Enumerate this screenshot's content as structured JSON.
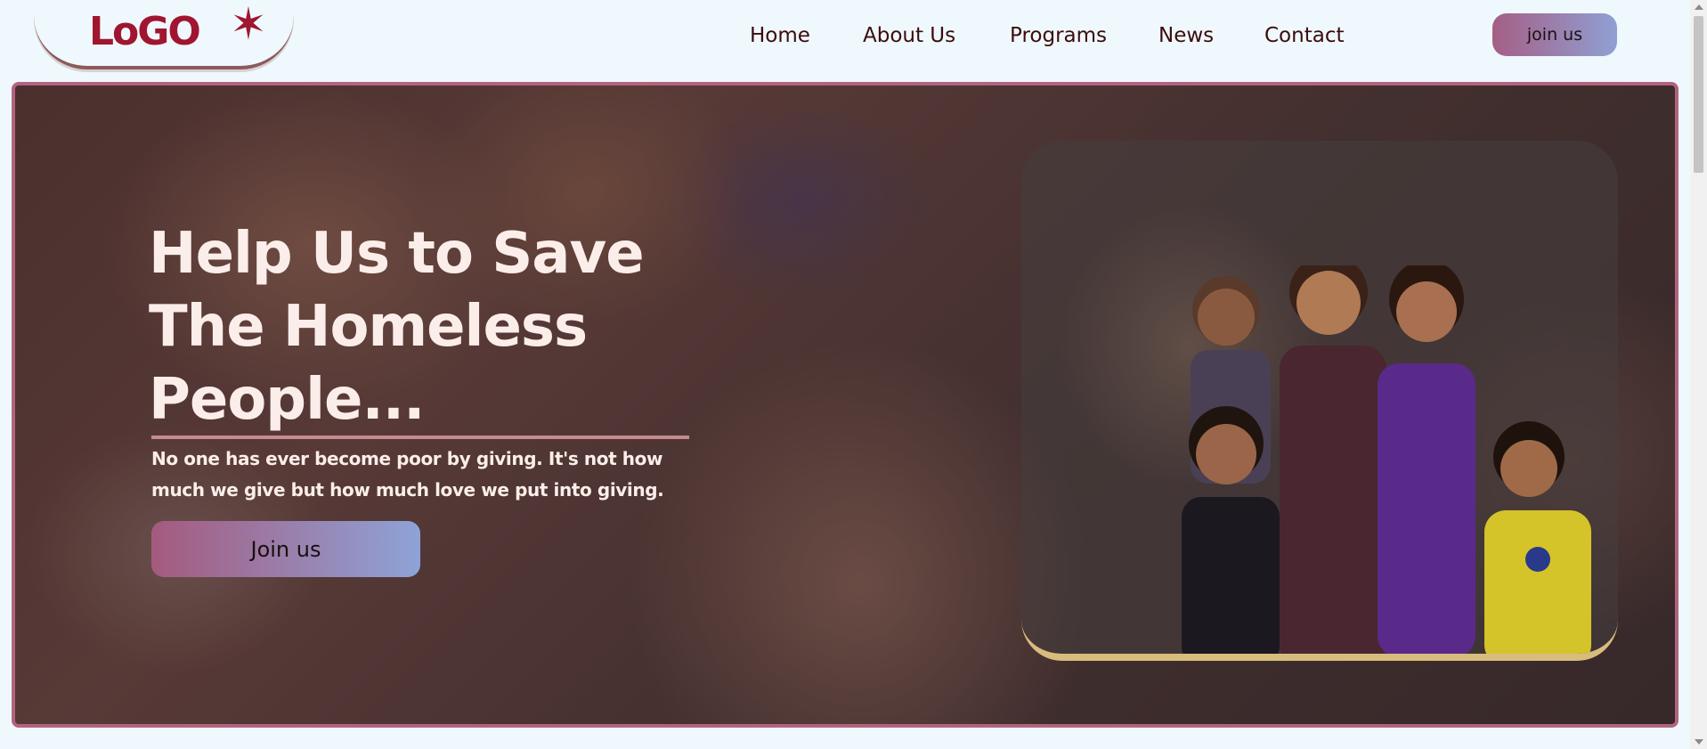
{
  "header": {
    "logo_text": "LoGO",
    "logo_star": "★",
    "nav": [
      "Home",
      "About Us",
      "Programs",
      "News",
      "Contact"
    ],
    "join_label": "join us"
  },
  "hero": {
    "title": "Help Us to Save The Homeless People...",
    "subtitle": "No one has ever become poor by giving. It's not how much we give but how much love we put into giving.",
    "join_label": "Join us"
  },
  "colors": {
    "background": "#eff8fc",
    "brand_red": "#a01530",
    "nav_text": "#3b0c0c",
    "hero_border": "#b2637f",
    "gradient_start": "#a55a7e",
    "gradient_end": "#8ea3d8",
    "card_accent": "#d8bc7d"
  }
}
